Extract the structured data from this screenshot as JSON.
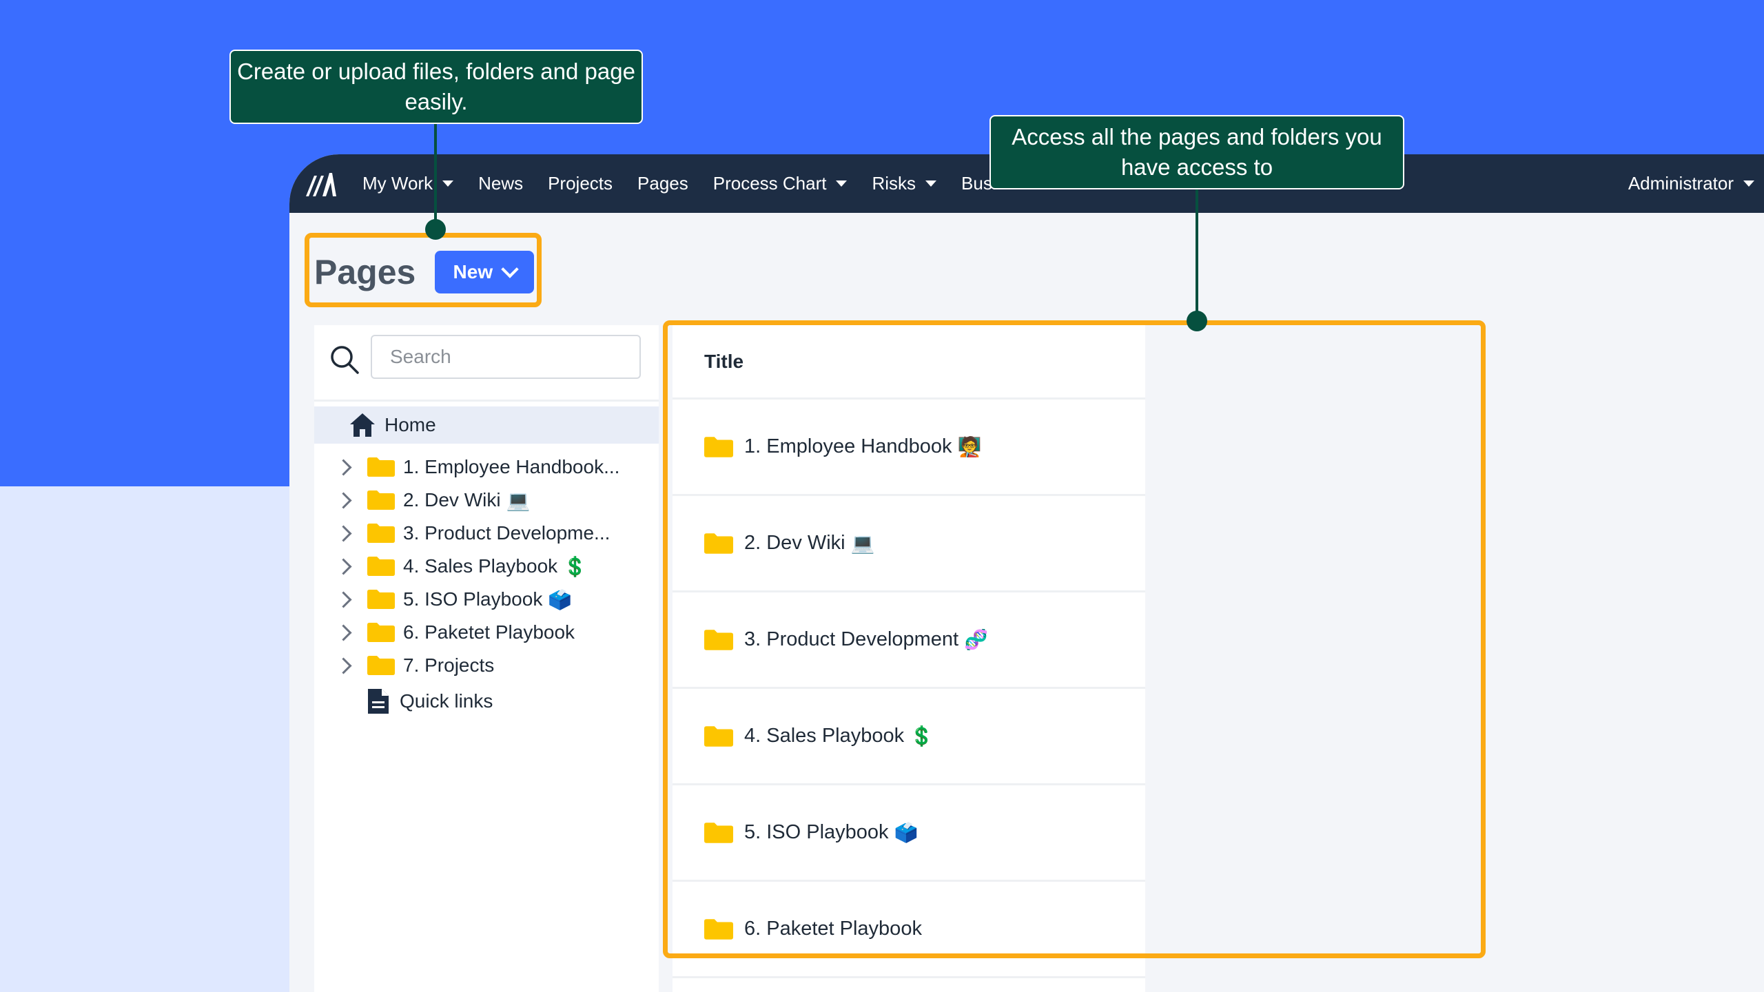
{
  "navbar": {
    "items": [
      {
        "label": "My Work",
        "has_caret": true
      },
      {
        "label": "News",
        "has_caret": false
      },
      {
        "label": "Projects",
        "has_caret": false
      },
      {
        "label": "Pages",
        "has_caret": false
      },
      {
        "label": "Process Chart",
        "has_caret": true
      },
      {
        "label": "Risks",
        "has_caret": true
      },
      {
        "label": "Busi",
        "has_caret": false
      }
    ],
    "user_menu": "Administrator"
  },
  "page": {
    "title": "Pages",
    "new_button": "New"
  },
  "sidebar": {
    "search_placeholder": "Search",
    "home": "Home",
    "items": [
      {
        "label": "1. Employee Handbook...",
        "emoji": ""
      },
      {
        "label": "2. Dev Wiki",
        "emoji": "💻"
      },
      {
        "label": "3. Product Developme...",
        "emoji": ""
      },
      {
        "label": "4. Sales Playbook",
        "emoji": "💲"
      },
      {
        "label": "5. ISO Playbook",
        "emoji": "🗳️"
      },
      {
        "label": "6. Paketet Playbook",
        "emoji": ""
      },
      {
        "label": "7. Projects",
        "emoji": ""
      }
    ],
    "quick_links": "Quick links"
  },
  "table": {
    "column_title": "Title",
    "rows": [
      {
        "title": "1. Employee Handbook",
        "emoji": "🧑‍🏫"
      },
      {
        "title": "2. Dev Wiki",
        "emoji": "💻"
      },
      {
        "title": "3. Product Development",
        "emoji": "🧬"
      },
      {
        "title": "4. Sales Playbook",
        "emoji": "💲"
      },
      {
        "title": "5. ISO Playbook",
        "emoji": "🗳️"
      },
      {
        "title": "6. Paketet Playbook",
        "emoji": ""
      }
    ]
  },
  "callouts": {
    "create": "Create or upload files, folders and page easily.",
    "access": "Access all the pages and folders you have access to"
  },
  "colors": {
    "brand_blue": "#3a6dff",
    "navbar": "#1d2d44",
    "callout_green": "#06503f",
    "highlight_orange": "#fbaa15",
    "folder_yellow": "#fdc500"
  }
}
